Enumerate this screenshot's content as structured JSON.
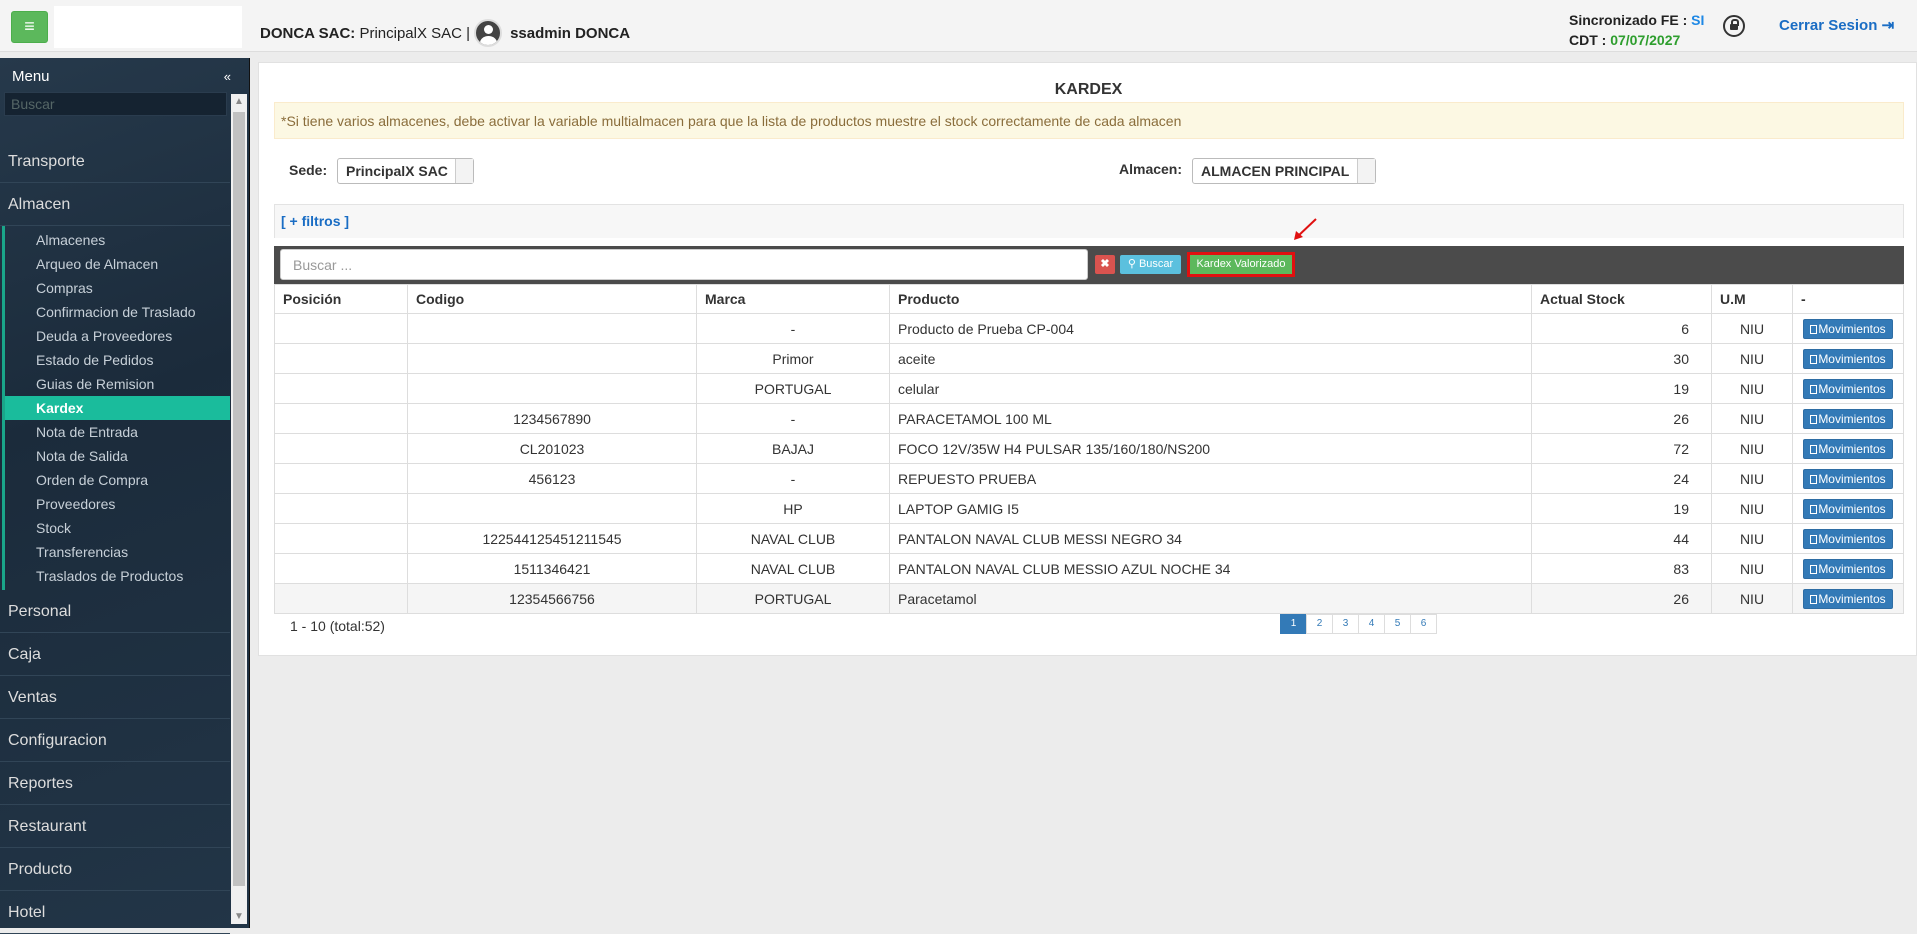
{
  "header": {
    "menu_button_icon": "hamburger-icon",
    "company_name": "DONCA SAC:",
    "branch": "PrincipalX SAC |",
    "user": "ssadmin DONCA",
    "sync_label": "Sincronizado FE :",
    "sync_value": "SI",
    "cdt_label": "CDT :",
    "cdt_value": "07/07/2027",
    "logout_label": "Cerrar Sesion"
  },
  "sidebar": {
    "title": "Menu",
    "search_placeholder": "Buscar",
    "categories_top": [
      "Transporte",
      "Almacen"
    ],
    "almacen_items": [
      "Almacenes",
      "Arqueo de Almacen",
      "Compras",
      "Confirmacion de Traslado",
      "Deuda a Proveedores",
      "Estado de Pedidos",
      "Guias de Remision",
      "Kardex",
      "Nota de Entrada",
      "Nota de Salida",
      "Orden de Compra",
      "Proveedores",
      "Stock",
      "Transferencias",
      "Traslados de Productos"
    ],
    "active_item": "Kardex",
    "categories_bottom": [
      "Personal",
      "Caja",
      "Ventas",
      "Configuracion",
      "Reportes",
      "Restaurant",
      "Producto",
      "Hotel"
    ]
  },
  "main": {
    "title": "KARDEX",
    "alert": "*Si tiene varios almacenes, debe activar la variable multialmacen para que la lista de productos muestre el stock correctamente de cada almacen",
    "sede_label": "Sede:",
    "sede_value": "PrincipalX SAC",
    "almacen_label": "Almacen:",
    "almacen_value": "ALMACEN PRINCIPAL",
    "filters_link": "[ + filtros ]",
    "search_placeholder": "Buscar ...",
    "buscar_button": "Buscar",
    "kardex_button": "Kardex Valorizado",
    "columns": [
      "Posición",
      "Codigo",
      "Marca",
      "Producto",
      "Actual Stock",
      "U.M",
      "-"
    ],
    "rows": [
      {
        "posicion": "",
        "codigo": "",
        "marca": "-",
        "producto": "Producto de Prueba CP-004",
        "stock": "6",
        "um": "NIU"
      },
      {
        "posicion": "",
        "codigo": "",
        "marca": "Primor",
        "producto": "aceite",
        "stock": "30",
        "um": "NIU"
      },
      {
        "posicion": "",
        "codigo": "",
        "marca": "PORTUGAL",
        "producto": "celular",
        "stock": "19",
        "um": "NIU"
      },
      {
        "posicion": "",
        "codigo": "1234567890",
        "marca": "-",
        "producto": "PARACETAMOL 100 ML",
        "stock": "26",
        "um": "NIU"
      },
      {
        "posicion": "",
        "codigo": "CL201023",
        "marca": "BAJAJ",
        "producto": "FOCO 12V/35W H4 PULSAR 135/160/180/NS200",
        "stock": "72",
        "um": "NIU"
      },
      {
        "posicion": "",
        "codigo": "456123",
        "marca": "-",
        "producto": "REPUESTO PRUEBA",
        "stock": "24",
        "um": "NIU"
      },
      {
        "posicion": "",
        "codigo": "",
        "marca": "HP",
        "producto": "LAPTOP GAMIG I5",
        "stock": "19",
        "um": "NIU"
      },
      {
        "posicion": "",
        "codigo": "122544125451211545",
        "marca": "NAVAL CLUB",
        "producto": "PANTALON NAVAL CLUB MESSI NEGRO 34",
        "stock": "44",
        "um": "NIU"
      },
      {
        "posicion": "",
        "codigo": "1511346421",
        "marca": "NAVAL CLUB",
        "producto": "PANTALON NAVAL CLUB MESSIO AZUL NOCHE 34",
        "stock": "83",
        "um": "NIU"
      },
      {
        "posicion": "",
        "codigo": "12354566756",
        "marca": "PORTUGAL",
        "producto": "Paracetamol",
        "stock": "26",
        "um": "NIU"
      }
    ],
    "row_action": "Movimientos",
    "range_text": "1 - 10 (total:52)",
    "pages": [
      "1",
      "2",
      "3",
      "4",
      "5",
      "6"
    ],
    "active_page": "1"
  },
  "colors": {
    "accent_green": "#5cb85c",
    "active_menu": "#1abc9c",
    "primary_blue": "#337ab7",
    "highlight_red": "#e01010"
  }
}
